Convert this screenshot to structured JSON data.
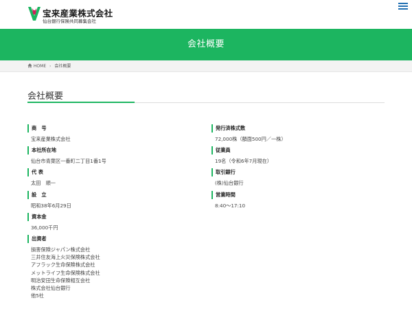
{
  "header": {
    "company_name": "宝来産業株式会社",
    "subtitle": "仙台銀行保険共同募集会社",
    "logo_colors": [
      "#1cb560",
      "#d11f5c"
    ],
    "menu_icon": "hamburger-menu-icon",
    "accent_color": "#1f6fb2"
  },
  "banner": {
    "title": "会社概要",
    "color": "#1cb560"
  },
  "breadcrumb": {
    "home_icon": "home-icon",
    "home": "HOME",
    "current": "会社概要"
  },
  "page": {
    "title": "会社概要"
  },
  "left_items": [
    {
      "label": "商　号",
      "values": [
        "宝来産業株式会社"
      ]
    },
    {
      "label": "本社所在地",
      "values": [
        "仙台市青葉区一番町二丁目1番1号"
      ]
    },
    {
      "label": "代 表",
      "values": [
        "太田　順一"
      ]
    },
    {
      "label": "設　立",
      "values": [
        "昭和38年6月29日"
      ]
    },
    {
      "label": "資本金",
      "values": [
        "36,000千円"
      ]
    },
    {
      "label": "出資者",
      "values": [
        "損害保険ジャパン株式会社",
        "三井住友海上火災保険株式会社",
        "アフラック生命保険株式会社",
        "メットライフ生命保険株式会社",
        "明治安田生命保険相互会社",
        "株式会社仙台銀行",
        "他5社"
      ]
    }
  ],
  "right_items": [
    {
      "label": "発行済株式数",
      "values": [
        "72,000株（額面500円／一株）"
      ]
    },
    {
      "label": "従業員",
      "values": [
        "19名（令和6年7月現在）"
      ]
    },
    {
      "label": "取引銀行",
      "values": [
        "(株)仙台銀行"
      ]
    },
    {
      "label": "営業時間",
      "values": [
        "8:40〜17:10"
      ]
    }
  ]
}
